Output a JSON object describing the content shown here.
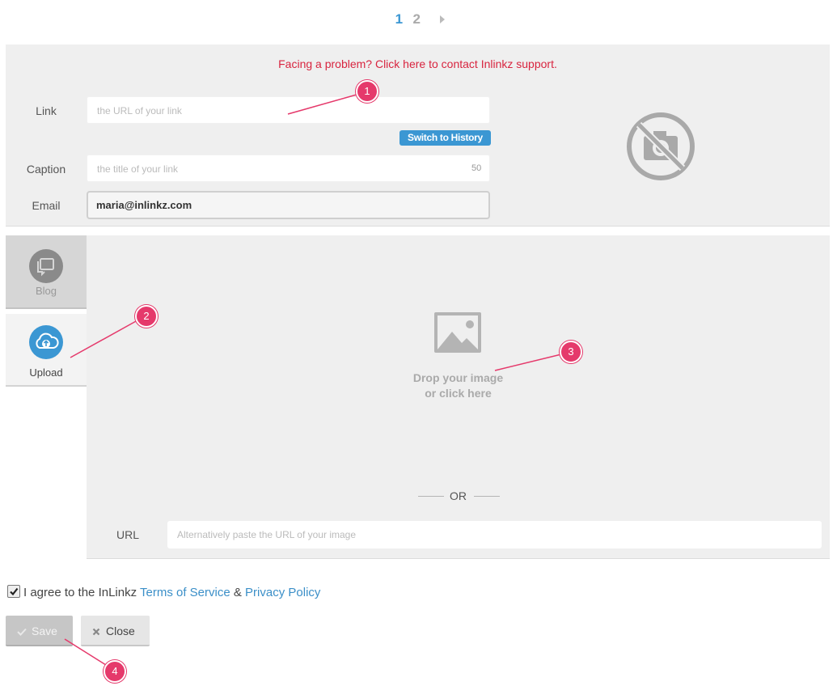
{
  "pagination": {
    "current": "1",
    "next": "2",
    "next_icon": "caret-right-icon"
  },
  "support": {
    "text": "Facing a problem? Click here to contact Inlinkz support."
  },
  "form": {
    "link_label": "Link",
    "link_placeholder": "the URL of your link",
    "switch_history": "Switch to History",
    "caption_label": "Caption",
    "caption_placeholder": "the title of your link",
    "caption_counter": "50",
    "email_label": "Email",
    "email_value": "maria@inlinkz.com"
  },
  "preview": {
    "icon": "no-camera-icon"
  },
  "tabs": [
    {
      "label": "Blog",
      "icon": "blog-icon",
      "active": false
    },
    {
      "label": "Upload",
      "icon": "cloud-upload-icon",
      "active": true
    }
  ],
  "upload": {
    "drop_line1": "Drop your image",
    "drop_line2": "or click here",
    "or_text": "OR",
    "url_label": "URL",
    "url_placeholder": "Alternatively paste the URL of your image"
  },
  "agreement": {
    "checked": true,
    "prefix": "I agree to the InLinkz ",
    "terms": "Terms of Service",
    "amp": " & ",
    "privacy": "Privacy Policy"
  },
  "buttons": {
    "save": "Save",
    "close": "Close"
  },
  "annotations": [
    "1",
    "2",
    "3",
    "4"
  ],
  "colors": {
    "accent": "#3b97d3",
    "support_red": "#d8243f",
    "badge": "#e5396b"
  }
}
